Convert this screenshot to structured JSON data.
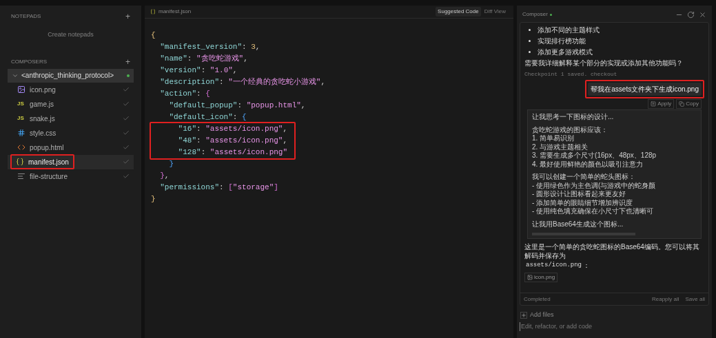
{
  "sidebar": {
    "notepads": {
      "title": "NOTEPADS",
      "add": "+",
      "empty": "Create notepads"
    },
    "composers": {
      "title": "COMPOSERS",
      "add": "+",
      "group": {
        "label": "<anthropic_thinking_protocol>",
        "expanded": true,
        "active": true,
        "files": [
          {
            "name": "icon.png",
            "kind": "image",
            "done": true,
            "selected": false,
            "highlighted": false
          },
          {
            "name": "game.js",
            "kind": "js",
            "badge": "JS",
            "done": true,
            "selected": false,
            "highlighted": false
          },
          {
            "name": "snake.js",
            "kind": "js",
            "badge": "JS",
            "done": true,
            "selected": false,
            "highlighted": false
          },
          {
            "name": "style.css",
            "kind": "css",
            "done": true,
            "selected": false,
            "highlighted": false
          },
          {
            "name": "popup.html",
            "kind": "html",
            "done": true,
            "selected": false,
            "highlighted": false
          },
          {
            "name": "manifest.json",
            "kind": "json",
            "done": true,
            "selected": true,
            "highlighted": true
          },
          {
            "name": "file-structure",
            "kind": "text",
            "done": true,
            "selected": false,
            "highlighted": false
          }
        ]
      }
    }
  },
  "editor": {
    "tab": "manifest.json",
    "views": [
      {
        "label": "Suggested Code",
        "selected": true
      },
      {
        "label": "Diff View",
        "selected": false
      }
    ],
    "lines": [
      {
        "highlighted": false,
        "tokens": [
          {
            "kind": "brace",
            "text": "{"
          }
        ]
      },
      {
        "highlighted": false,
        "tokens": [
          {
            "kind": "key",
            "text": "  \"manifest_version\""
          },
          {
            "kind": "punct",
            "text": ": "
          },
          {
            "kind": "number",
            "text": "3"
          },
          {
            "kind": "punct",
            "text": ","
          }
        ]
      },
      {
        "highlighted": false,
        "tokens": [
          {
            "kind": "key",
            "text": "  \"name\""
          },
          {
            "kind": "punct",
            "text": ": "
          },
          {
            "kind": "string",
            "text": "\"贪吃蛇游戏\""
          },
          {
            "kind": "punct",
            "text": ","
          }
        ]
      },
      {
        "highlighted": false,
        "tokens": [
          {
            "kind": "key",
            "text": "  \"version\""
          },
          {
            "kind": "punct",
            "text": ": "
          },
          {
            "kind": "string",
            "text": "\"1.0\""
          },
          {
            "kind": "punct",
            "text": ","
          }
        ]
      },
      {
        "highlighted": false,
        "tokens": [
          {
            "kind": "key",
            "text": "  \"description\""
          },
          {
            "kind": "punct",
            "text": ": "
          },
          {
            "kind": "string",
            "text": "\"一个经典的贪吃蛇小游戏\""
          },
          {
            "kind": "punct",
            "text": ","
          }
        ]
      },
      {
        "highlighted": false,
        "tokens": [
          {
            "kind": "key",
            "text": "  \"action\""
          },
          {
            "kind": "punct",
            "text": ": "
          },
          {
            "kind": "brace2",
            "text": "{"
          }
        ]
      },
      {
        "highlighted": false,
        "tokens": [
          {
            "kind": "key",
            "text": "    \"default_popup\""
          },
          {
            "kind": "punct",
            "text": ": "
          },
          {
            "kind": "string",
            "text": "\"popup.html\""
          },
          {
            "kind": "punct",
            "text": ","
          }
        ]
      },
      {
        "highlighted": false,
        "tokens": [
          {
            "kind": "key",
            "text": "    \"default_icon\""
          },
          {
            "kind": "punct",
            "text": ": "
          },
          {
            "kind": "brace3",
            "text": "{"
          }
        ]
      },
      {
        "highlighted": true,
        "tokens": [
          {
            "kind": "key",
            "text": "      \"16\""
          },
          {
            "kind": "punct",
            "text": ": "
          },
          {
            "kind": "string",
            "text": "\"assets/icon.png\""
          },
          {
            "kind": "punct",
            "text": ","
          }
        ]
      },
      {
        "highlighted": true,
        "tokens": [
          {
            "kind": "key",
            "text": "      \"48\""
          },
          {
            "kind": "punct",
            "text": ": "
          },
          {
            "kind": "string",
            "text": "\"assets/icon.png\""
          },
          {
            "kind": "punct",
            "text": ","
          }
        ]
      },
      {
        "highlighted": true,
        "tokens": [
          {
            "kind": "key",
            "text": "      \"128\""
          },
          {
            "kind": "punct",
            "text": ": "
          },
          {
            "kind": "string",
            "text": "\"assets/icon.png\""
          }
        ]
      },
      {
        "highlighted": false,
        "tokens": [
          {
            "kind": "brace3",
            "text": "    }"
          }
        ]
      },
      {
        "highlighted": false,
        "tokens": [
          {
            "kind": "brace2",
            "text": "  }"
          },
          {
            "kind": "punct",
            "text": ","
          }
        ]
      },
      {
        "highlighted": false,
        "tokens": [
          {
            "kind": "key",
            "text": "  \"permissions\""
          },
          {
            "kind": "punct",
            "text": ": "
          },
          {
            "kind": "brace2",
            "text": "["
          },
          {
            "kind": "string",
            "text": "\"storage\""
          },
          {
            "kind": "brace2",
            "text": "]"
          }
        ]
      },
      {
        "highlighted": false,
        "tokens": [
          {
            "kind": "brace",
            "text": "}"
          }
        ]
      }
    ]
  },
  "composer": {
    "title": "Composer",
    "live": true,
    "bullets": [
      "添加不同的主题样式",
      "实现排行榜功能",
      "添加更多游戏模式"
    ],
    "question": "需要我详细解释某个部分的实现或添加其他功能吗？",
    "checkpoint": "Checkpoint 1 saved. checkout",
    "user_message": {
      "text": "帮我在assets文件夹下生成icon.png",
      "highlighted": true
    },
    "actions": [
      "Apply",
      "Copy"
    ],
    "thinking": [
      [
        "让我思考一下图标的设计..."
      ],
      [
        "贪吃蛇游戏的图标应该：",
        "1. 简单易识别",
        "2. 与游戏主题相关",
        "3. 需要生成多个尺寸(16px、48px、128p",
        "4. 最好使用鲜艳的颜色以吸引注意力"
      ],
      [
        "我可以创建一个简单的蛇头图标：",
        "- 使用绿色作为主色调(与游戏中的蛇身颜",
        "- 圆形设计让图标看起来更友好",
        "- 添加简单的眼睛细节增加辨识度",
        "- 使用纯色填充确保在小尺寸下也清晰可"
      ],
      [
        "让我用Base64生成这个图标..."
      ]
    ],
    "reply": "这里是一个简单的贪吃蛇图标的Base64编码。您可以将其解码并保存为",
    "reply_code": "assets/icon.png",
    "reply_end": "：",
    "file_chip": "icon.png",
    "status": "Completed",
    "footer_actions": [
      "Reapply all",
      "Save all"
    ],
    "add_files": "Add files",
    "input": {
      "placeholder": "Edit, refactor, or add code"
    }
  }
}
